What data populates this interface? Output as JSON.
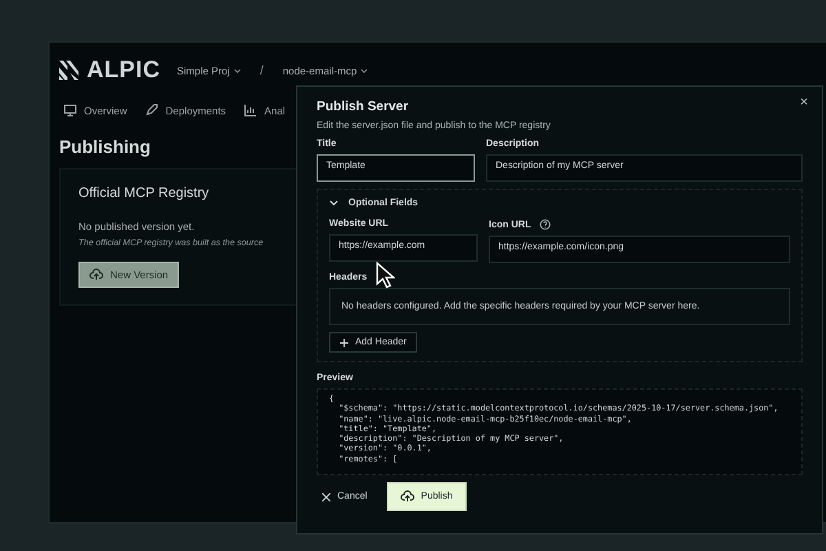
{
  "app": {
    "logo": "ALPIC",
    "project": "Simple Proj",
    "separator": "/",
    "server": "node-email-mcp"
  },
  "nav_tabs": [
    {
      "label": "Overview"
    },
    {
      "label": "Deployments"
    },
    {
      "label": "Anal"
    }
  ],
  "page": {
    "title": "Publishing",
    "card": {
      "title": "Official MCP Registry",
      "status": "No published version yet.",
      "note": "The official MCP registry was built as the source",
      "button": "New Version"
    }
  },
  "dialog": {
    "title": "Publish Server",
    "subtitle": "Edit the server.json file and publish to the MCP registry",
    "close": "×",
    "title_field": {
      "label": "Title",
      "value": "Template",
      "focused": true
    },
    "description_field": {
      "label": "Description",
      "value": "Description of my MCP server",
      "focused": false
    },
    "optional": {
      "label": "Optional Fields",
      "expanded": true,
      "website_field": {
        "label": "Website URL",
        "value": "https://example.com"
      },
      "icon_field": {
        "label": "Icon URL",
        "value": "https://example.com/icon.png"
      },
      "headers": {
        "label": "Headers",
        "empty_text": "No headers configured. Add the specific headers required by your MCP server here.",
        "button": "Add Header"
      }
    },
    "preview": {
      "label": "Preview",
      "lines": [
        "{",
        "  \"$schema\": \"https://static.modelcontextprotocol.io/schemas/2025-10-17/server.schema.json\",",
        "  \"name\": \"live.alpic.node-email-mcp-b25f10ec/node-email-mcp\",",
        "  \"title\": \"Template\",",
        "  \"description\": \"Description of my MCP server\",",
        "  \"version\": \"0.0.1\",",
        "  \"remotes\": ["
      ]
    },
    "cancel": "Cancel",
    "publish": "Publish"
  }
}
